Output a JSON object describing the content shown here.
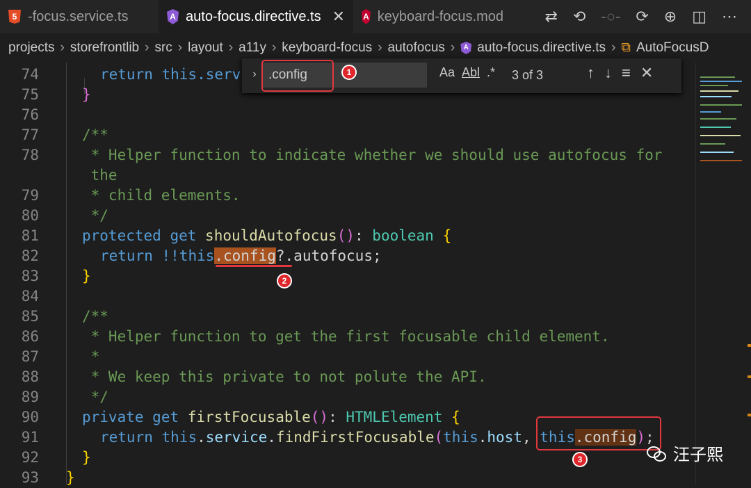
{
  "tabs": [
    {
      "label": "-focus.service.ts",
      "icon": "html-icon"
    },
    {
      "label": "auto-focus.directive.ts",
      "icon": "angular-icon",
      "active": true
    },
    {
      "label": "keyboard-focus.mod",
      "icon": "angular-icon"
    }
  ],
  "toolbar": [
    "git-compare-icon",
    "go-back-icon",
    "commit-icon",
    "go-forward-icon",
    "timeline-icon",
    "split-editor-icon",
    "more-icon"
  ],
  "breadcrumb": [
    "projects",
    "storefrontlib",
    "src",
    "layout",
    "a11y",
    "keyboard-focus",
    "autofocus",
    "auto-focus.directive.ts",
    "AutoFocusD"
  ],
  "find": {
    "query": ".config",
    "match_case": "Aa",
    "whole_word": "Abl",
    "regex": ".*",
    "count": "3 of 3"
  },
  "lines": {
    "n74": "74",
    "n75": "75",
    "n76": "76",
    "n77": "77",
    "n78": "78",
    "n79": "79",
    "n80": "80",
    "n81": "81",
    "n82": "82",
    "n83": "83",
    "n84": "84",
    "n85": "85",
    "n86": "86",
    "n87": "87",
    "n88": "88",
    "n89": "89",
    "n90": "90",
    "n91": "91",
    "n92": "92",
    "n93": "93"
  },
  "code": {
    "l74": "return this.serv",
    "l77": "/**",
    "l78a": " * Helper function to indicate whether we should use autofocus for",
    "l78b": " the",
    "l79": " * child elements.",
    "l80": " */",
    "l81_kw": "protected",
    "l81_get": "get",
    "l81_fn": "shouldAutofocus",
    "l81_ty": "boolean",
    "l82_pre": "return !!",
    "l82_this": "this",
    "l82_cfg": ".config",
    "l82_rest": "?.autofocus;",
    "l85": "/**",
    "l86": " * Helper function to get the first focusable child element.",
    "l87": " *",
    "l88": " * We keep this private to not polute the API.",
    "l89": " */",
    "l90_kw": "private",
    "l90_get": "get",
    "l90_fn": "firstFocusable",
    "l90_ty": "HTMLElement",
    "l91_ret": "return",
    "l91_this1": "this",
    "l91_service": "service",
    "l91_fn": "findFirstFocusable",
    "l91_this2": "this",
    "l91_host": "host",
    "l91_this3": "this",
    "l91_cfg": ".config"
  },
  "annotations": [
    "1",
    "2",
    "3"
  ],
  "watermark": "汪子熙",
  "colors": {
    "annotation": "#e0383e",
    "match": "#613214",
    "current_match": "#a8521f"
  }
}
